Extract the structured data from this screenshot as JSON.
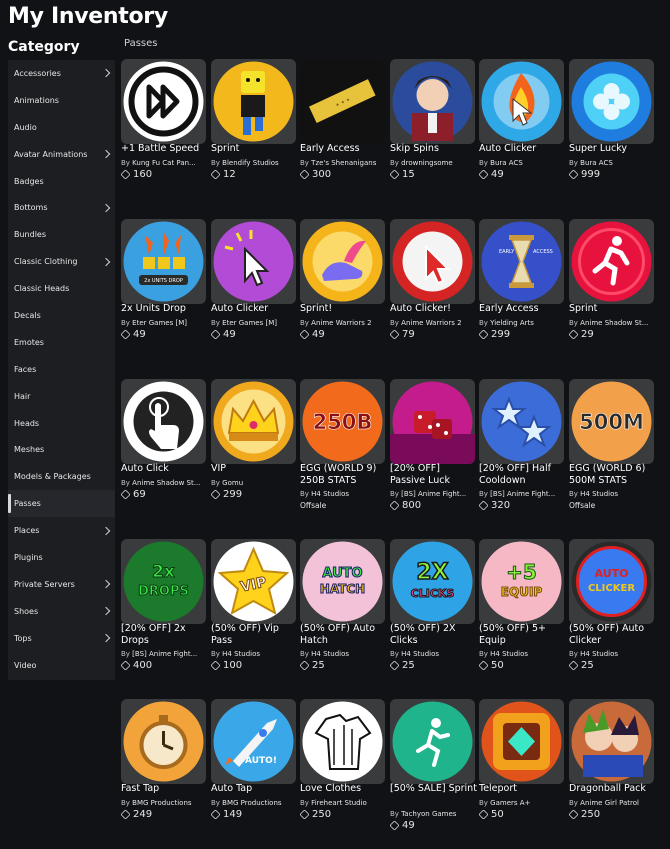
{
  "title": "My Inventory",
  "category_heading": "Category",
  "section": "Passes",
  "sidebar": [
    {
      "label": "Accessories",
      "chevron": true
    },
    {
      "label": "Animations",
      "chevron": false
    },
    {
      "label": "Audio",
      "chevron": false
    },
    {
      "label": "Avatar Animations",
      "chevron": true
    },
    {
      "label": "Badges",
      "chevron": false
    },
    {
      "label": "Bottoms",
      "chevron": true
    },
    {
      "label": "Bundles",
      "chevron": false
    },
    {
      "label": "Classic Clothing",
      "chevron": true
    },
    {
      "label": "Classic Heads",
      "chevron": false
    },
    {
      "label": "Decals",
      "chevron": false
    },
    {
      "label": "Emotes",
      "chevron": false
    },
    {
      "label": "Faces",
      "chevron": false
    },
    {
      "label": "Hair",
      "chevron": false
    },
    {
      "label": "Heads",
      "chevron": false
    },
    {
      "label": "Meshes",
      "chevron": false
    },
    {
      "label": "Models & Packages",
      "chevron": false
    },
    {
      "label": "Passes",
      "chevron": false,
      "active": true
    },
    {
      "label": "Places",
      "chevron": true
    },
    {
      "label": "Plugins",
      "chevron": false
    },
    {
      "label": "Private Servers",
      "chevron": true
    },
    {
      "label": "Shoes",
      "chevron": true
    },
    {
      "label": "Tops",
      "chevron": true
    },
    {
      "label": "Video",
      "chevron": false
    }
  ],
  "items": [
    {
      "name": "+1 Battle Speed",
      "creator": "Kung Fu Cat Pan...",
      "price": "160",
      "icon": "fast-forward-icon",
      "bg": "#ffffff"
    },
    {
      "name": "Sprint",
      "creator": "Blendify Studios",
      "price": "12",
      "icon": "running-noob-icon",
      "bg": "#f2b81c"
    },
    {
      "name": "Early Access",
      "creator": "Tze's Shenanigans",
      "price": "300",
      "icon": "golden-ticket-icon",
      "bg": "#111111"
    },
    {
      "name": "Skip Spins",
      "creator": "drowningsome",
      "price": "15",
      "icon": "anime-character-icon",
      "bg": "#2b4c9c"
    },
    {
      "name": "Auto Clicker",
      "creator": "Bura ACS",
      "price": "49",
      "icon": "fire-cursor-icon",
      "bg": "#2fa8e8"
    },
    {
      "name": "Super Lucky",
      "creator": "Bura ACS",
      "price": "999",
      "icon": "clover-icon",
      "bg": "#1f7de0"
    },
    {
      "name": "2x Units Drop",
      "creator": "Eter Games [M]",
      "price": "49",
      "icon": "units-drop-icon",
      "bg": "#3aa0e0"
    },
    {
      "name": "Auto Clicker",
      "creator": "Eter Games [M]",
      "price": "49",
      "icon": "cursor-click-icon",
      "bg": "#b24bd6"
    },
    {
      "name": "Sprint!",
      "creator": "Anime Warriors 2",
      "price": "49",
      "icon": "winged-shoe-icon",
      "bg": "#f4b41a"
    },
    {
      "name": "Auto Clicker!",
      "creator": "Anime Warriors 2",
      "price": "79",
      "icon": "burst-cursor-icon",
      "bg": "#d42424"
    },
    {
      "name": "Early Access",
      "creator": "Yielding Arts",
      "price": "299",
      "icon": "hourglass-icon",
      "bg": "#3550c8"
    },
    {
      "name": "Sprint",
      "creator": "Anime Shadow St...",
      "price": "29",
      "icon": "runner-icon",
      "bg": "#e8123e"
    },
    {
      "name": "Auto Click",
      "creator": "Anime Shadow St...",
      "price": "69",
      "icon": "tap-hand-icon",
      "bg": "#ffffff"
    },
    {
      "name": "VIP",
      "creator": "Gomu",
      "price": "299",
      "icon": "crown-icon",
      "bg": "#f0a81c"
    },
    {
      "name": "EGG (WORLD 9) 250B STATS",
      "creator": "H4 Studios",
      "offsale": "Offsale",
      "icon": "250b-badge-icon",
      "bg": "#f26a1c",
      "badge_text": "250B"
    },
    {
      "name": "[20% OFF] Passive Luck",
      "creator": "[BS] Anime Fight...",
      "price": "800",
      "icon": "dice-icon",
      "bg": "#c41c8c"
    },
    {
      "name": "[20% OFF] Half Cooldown",
      "creator": "[BS] Anime Fight...",
      "price": "320",
      "icon": "stars-icon",
      "bg": "#3c6cd8"
    },
    {
      "name": "EGG (WORLD 6) 500M STATS",
      "creator": "H4 Studios",
      "offsale": "Offsale",
      "icon": "500m-badge-icon",
      "bg": "#f2a14a",
      "badge_text": "500M"
    },
    {
      "name": "[20% OFF] 2x Drops",
      "creator": "[BS] Anime Fight...",
      "price": "400",
      "icon": "2x-drops-icon",
      "bg": "#1c7a2c"
    },
    {
      "name": "(50% OFF) Vip Pass",
      "creator": "H4 Studios",
      "price": "100",
      "icon": "vip-star-icon",
      "bg": "#ffffff"
    },
    {
      "name": "(50% OFF) Auto Hatch",
      "creator": "H4 Studios",
      "price": "25",
      "icon": "auto-hatch-icon",
      "bg": "#f4c2d8"
    },
    {
      "name": "(50% OFF) 2X Clicks",
      "creator": "H4 Studios",
      "price": "25",
      "icon": "2x-clicks-icon",
      "bg": "#2ea4e6"
    },
    {
      "name": "(50% OFF) 5+ Equip",
      "creator": "H4 Studios",
      "price": "50",
      "icon": "plus5-equip-icon",
      "bg": "#f6b8c4"
    },
    {
      "name": "(50% OFF) Auto Clicker",
      "creator": "H4 Studios",
      "price": "25",
      "icon": "auto-clicker-text-icon",
      "bg": "#2a2a2a"
    },
    {
      "name": "Fast Tap",
      "creator": "BMG Productions",
      "price": "249",
      "icon": "stopwatch-icon",
      "bg": "#f2a43a"
    },
    {
      "name": "Auto Tap",
      "creator": "BMG Productions",
      "price": "149",
      "icon": "rocket-icon",
      "bg": "#3aa8e8"
    },
    {
      "name": "Love Clothes",
      "creator": "Fireheart Studio",
      "price": "250",
      "icon": "clothes-icon",
      "bg": "#ffffff"
    },
    {
      "name": "[50% SALE] Sprint",
      "creator": "Tachyon Games",
      "price": "49",
      "icon": "sprinter-icon",
      "bg": "#1fb48c"
    },
    {
      "name": "Teleport",
      "creator": "Gamers A+",
      "price": "50",
      "icon": "teleport-pad-icon",
      "bg": "#e0541c"
    },
    {
      "name": "Dragonball Pack",
      "creator": "Anime Girl Patrol",
      "price": "250",
      "icon": "dragonball-fighters-icon",
      "bg": "#c86a3a"
    }
  ]
}
